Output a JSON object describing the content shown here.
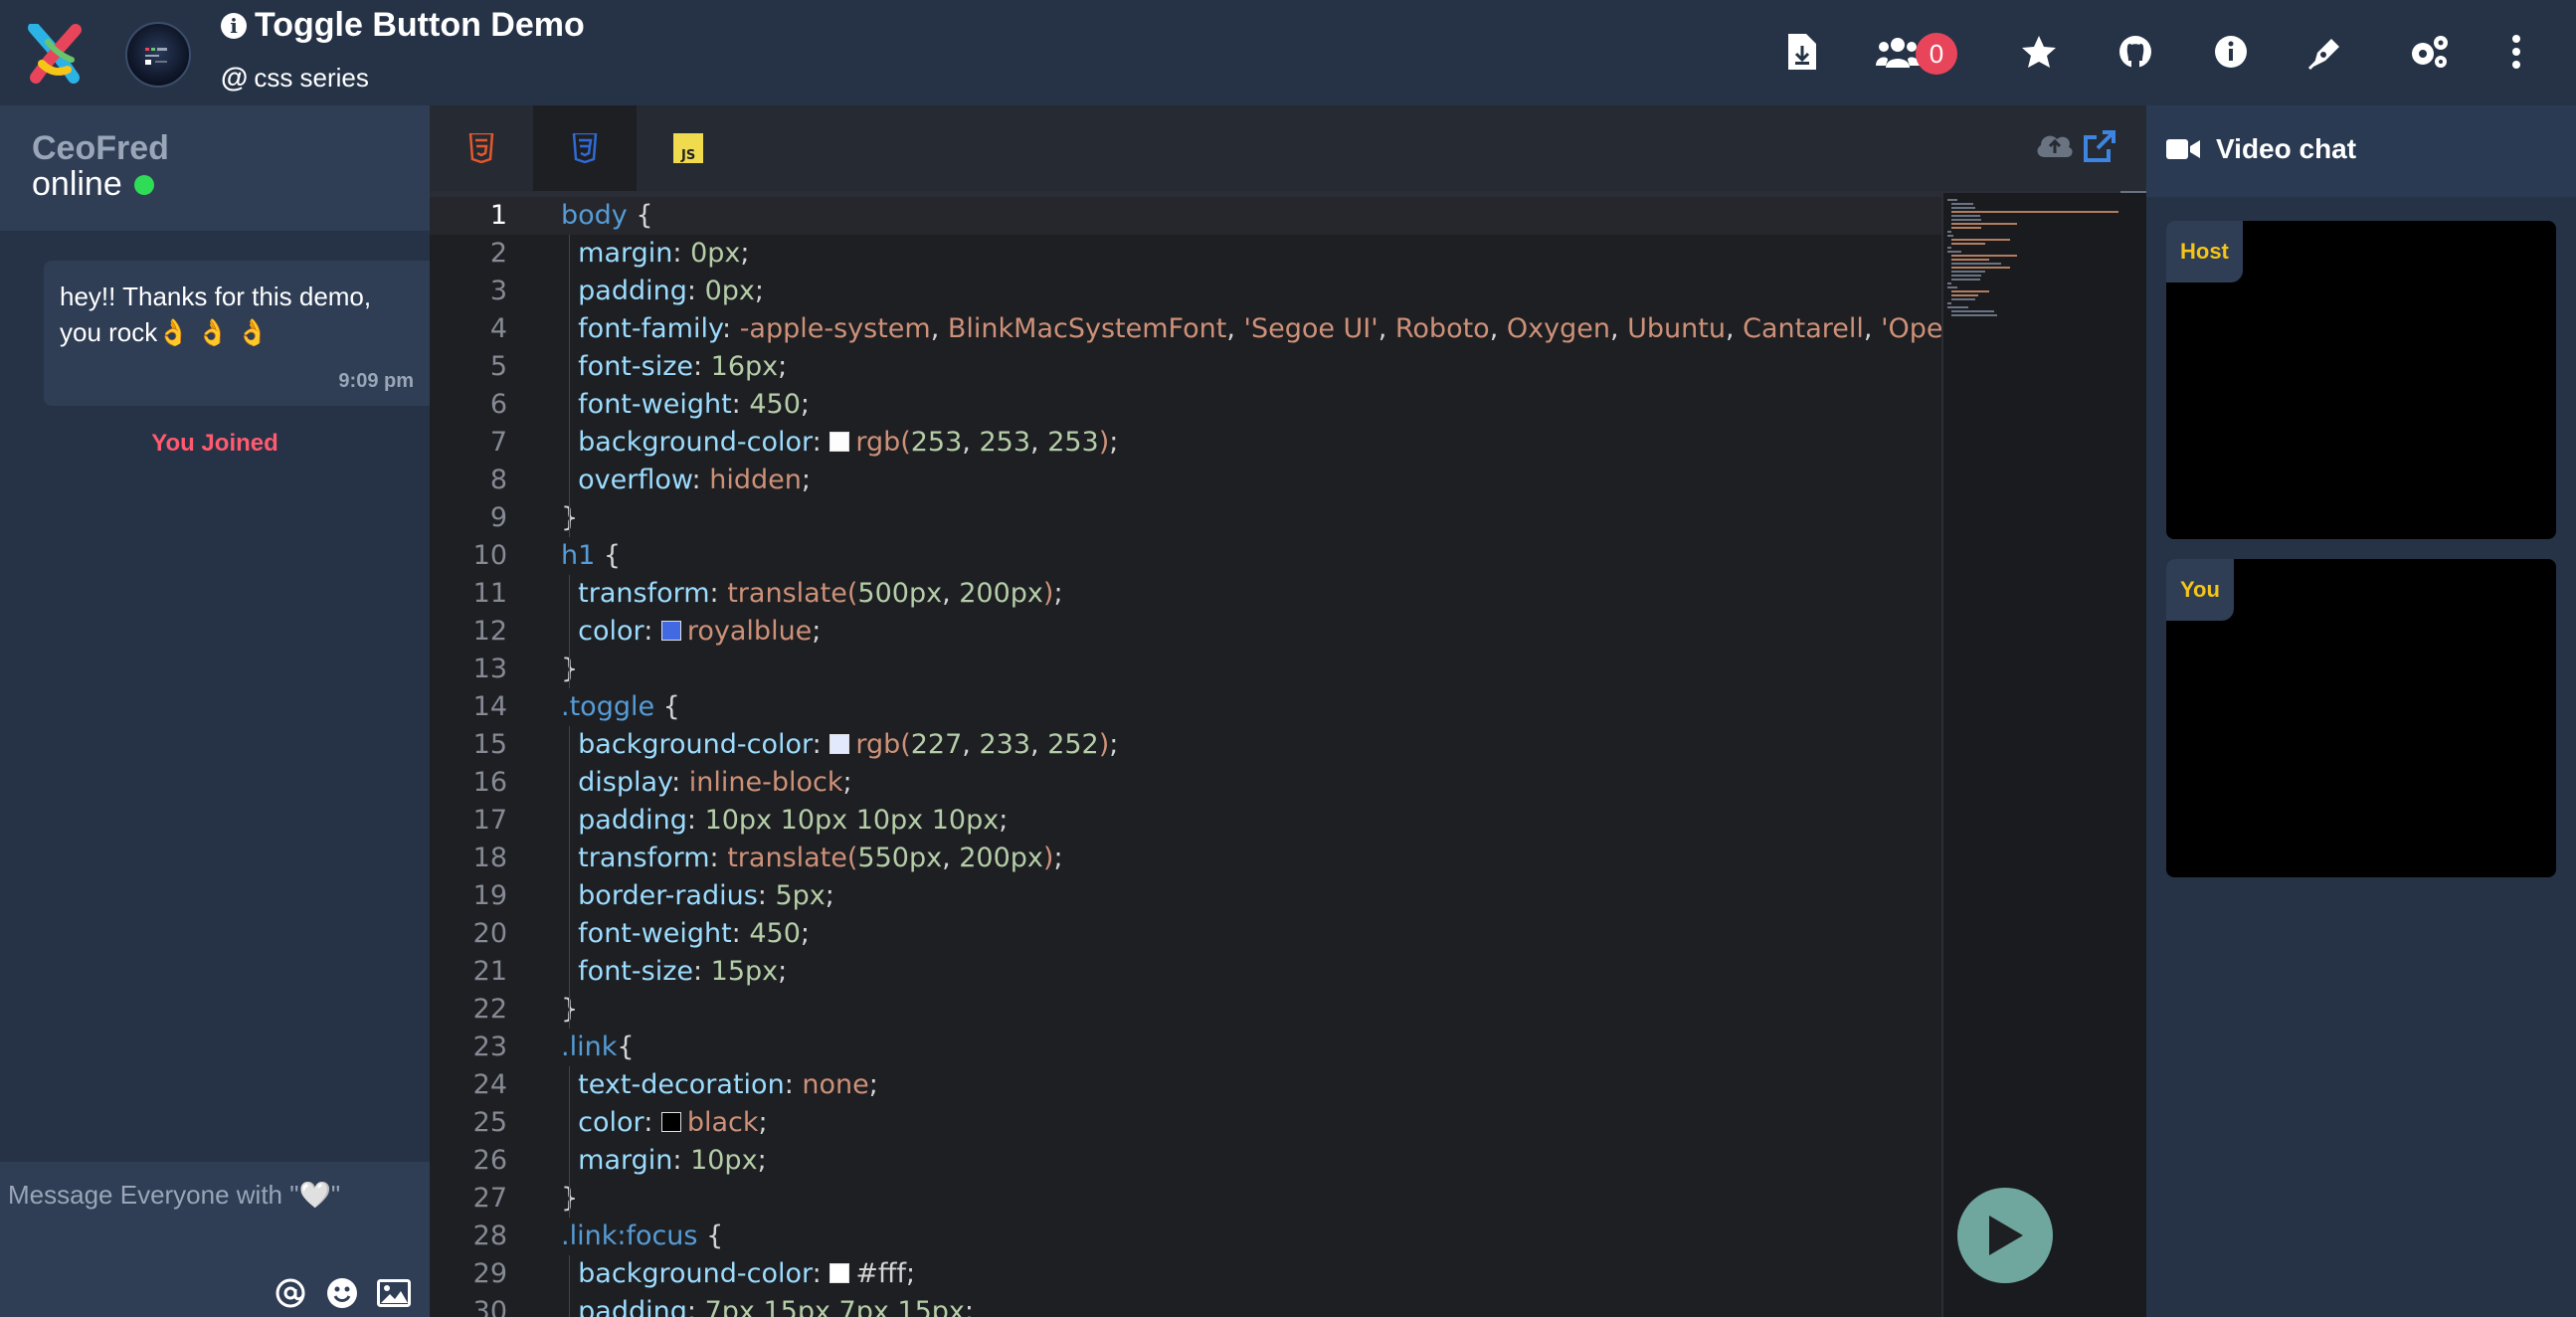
{
  "header": {
    "title": "Toggle Button Demo",
    "subtitle": "css series",
    "participant_count": "0",
    "icons": [
      "download-file-icon",
      "users-icon",
      "star-icon",
      "github-icon",
      "info-icon",
      "pen-icon",
      "settings-icon",
      "more-vertical-icon"
    ]
  },
  "chat": {
    "user_name": "CeoFred",
    "status": "online",
    "message_text": "hey!! Thanks for this demo, you rock👌 👌 👌",
    "message_time": "9:09 pm",
    "event_text": "You Joined",
    "composer_placeholder": "Message Everyone with \"🤍\""
  },
  "editor": {
    "tabs": [
      {
        "label": "HTML",
        "color": "#e4582c"
      },
      {
        "label": "CSS",
        "color": "#2f6ad6"
      },
      {
        "label": "JS",
        "color": "#f0db4f"
      }
    ],
    "active_tab": "CSS",
    "current_line": 1,
    "lines": [
      {
        "n": "1",
        "t": [
          [
            "sel",
            "body"
          ],
          [
            "p",
            " {"
          ]
        ]
      },
      {
        "n": "2",
        "t": [
          [
            "prop",
            "  margin"
          ],
          [
            "p",
            ": "
          ],
          [
            "num",
            "0px"
          ],
          [
            "p",
            ";"
          ]
        ]
      },
      {
        "n": "3",
        "t": [
          [
            "prop",
            "  padding"
          ],
          [
            "p",
            ": "
          ],
          [
            "num",
            "0px"
          ],
          [
            "p",
            ";"
          ]
        ]
      },
      {
        "n": "4",
        "t": [
          [
            "prop",
            "  font-family"
          ],
          [
            "p",
            ": "
          ],
          [
            "val",
            "-apple-system"
          ],
          [
            "p",
            ", "
          ],
          [
            "val",
            "BlinkMacSystemFont"
          ],
          [
            "p",
            ", "
          ],
          [
            "val",
            "'Segoe UI'"
          ],
          [
            "p",
            ", "
          ],
          [
            "val",
            "Roboto"
          ],
          [
            "p",
            ", "
          ],
          [
            "val",
            "Oxygen"
          ],
          [
            "p",
            ", "
          ],
          [
            "val",
            "Ubuntu"
          ],
          [
            "p",
            ", "
          ],
          [
            "val",
            "Cantarell"
          ],
          [
            "p",
            ", "
          ],
          [
            "val",
            "'Open Sa"
          ]
        ]
      },
      {
        "n": "5",
        "t": [
          [
            "prop",
            "  font-size"
          ],
          [
            "p",
            ": "
          ],
          [
            "num",
            "16px"
          ],
          [
            "p",
            ";"
          ]
        ]
      },
      {
        "n": "6",
        "t": [
          [
            "prop",
            "  font-weight"
          ],
          [
            "p",
            ": "
          ],
          [
            "num",
            "450"
          ],
          [
            "p",
            ";"
          ]
        ]
      },
      {
        "n": "7",
        "t": [
          [
            "prop",
            "  background-color"
          ],
          [
            "p",
            ": "
          ],
          [
            "sw",
            "#fdfdfd"
          ],
          [
            "val",
            "rgb("
          ],
          [
            "num",
            "253"
          ],
          [
            "p",
            ", "
          ],
          [
            "num",
            "253"
          ],
          [
            "p",
            ", "
          ],
          [
            "num",
            "253"
          ],
          [
            "val",
            ")"
          ],
          [
            "p",
            ";"
          ]
        ]
      },
      {
        "n": "8",
        "t": [
          [
            "prop",
            "  overflow"
          ],
          [
            "p",
            ": "
          ],
          [
            "val",
            "hidden"
          ],
          [
            "p",
            ";"
          ]
        ]
      },
      {
        "n": "9",
        "t": [
          [
            "p",
            "}"
          ]
        ]
      },
      {
        "n": "10",
        "t": [
          [
            "sel",
            "h1"
          ],
          [
            "p",
            " {"
          ]
        ]
      },
      {
        "n": "11",
        "t": [
          [
            "prop",
            "  transform"
          ],
          [
            "p",
            ": "
          ],
          [
            "val",
            "translate("
          ],
          [
            "num",
            "500px"
          ],
          [
            "p",
            ", "
          ],
          [
            "num",
            "200px"
          ],
          [
            "val",
            ")"
          ],
          [
            "p",
            ";"
          ]
        ]
      },
      {
        "n": "12",
        "t": [
          [
            "prop",
            "  color"
          ],
          [
            "p",
            ": "
          ],
          [
            "sw",
            "#4169e1"
          ],
          [
            "val",
            "royalblue"
          ],
          [
            "p",
            ";"
          ]
        ]
      },
      {
        "n": "13",
        "t": [
          [
            "p",
            "}"
          ]
        ]
      },
      {
        "n": "14",
        "t": [
          [
            "sel",
            ".toggle"
          ],
          [
            "p",
            " {"
          ]
        ]
      },
      {
        "n": "15",
        "t": [
          [
            "prop",
            "  background-color"
          ],
          [
            "p",
            ": "
          ],
          [
            "sw",
            "#e3e9fc"
          ],
          [
            "val",
            "rgb("
          ],
          [
            "num",
            "227"
          ],
          [
            "p",
            ", "
          ],
          [
            "num",
            "233"
          ],
          [
            "p",
            ", "
          ],
          [
            "num",
            "252"
          ],
          [
            "val",
            ")"
          ],
          [
            "p",
            ";"
          ]
        ]
      },
      {
        "n": "16",
        "t": [
          [
            "prop",
            "  display"
          ],
          [
            "p",
            ": "
          ],
          [
            "val",
            "inline-block"
          ],
          [
            "p",
            ";"
          ]
        ]
      },
      {
        "n": "17",
        "t": [
          [
            "prop",
            "  padding"
          ],
          [
            "p",
            ": "
          ],
          [
            "num",
            "10px 10px 10px 10px"
          ],
          [
            "p",
            ";"
          ]
        ]
      },
      {
        "n": "18",
        "t": [
          [
            "prop",
            "  transform"
          ],
          [
            "p",
            ": "
          ],
          [
            "val",
            "translate("
          ],
          [
            "num",
            "550px"
          ],
          [
            "p",
            ", "
          ],
          [
            "num",
            "200px"
          ],
          [
            "val",
            ")"
          ],
          [
            "p",
            ";"
          ]
        ]
      },
      {
        "n": "19",
        "t": [
          [
            "prop",
            "  border-radius"
          ],
          [
            "p",
            ": "
          ],
          [
            "num",
            "5px"
          ],
          [
            "p",
            ";"
          ]
        ]
      },
      {
        "n": "20",
        "t": [
          [
            "prop",
            "  font-weight"
          ],
          [
            "p",
            ": "
          ],
          [
            "num",
            "450"
          ],
          [
            "p",
            ";"
          ]
        ]
      },
      {
        "n": "21",
        "t": [
          [
            "prop",
            "  font-size"
          ],
          [
            "p",
            ": "
          ],
          [
            "num",
            "15px"
          ],
          [
            "p",
            ";"
          ]
        ]
      },
      {
        "n": "22",
        "t": [
          [
            "p",
            "}"
          ]
        ]
      },
      {
        "n": "23",
        "t": [
          [
            "sel",
            ".link"
          ],
          [
            "p",
            "{"
          ]
        ]
      },
      {
        "n": "24",
        "t": [
          [
            "prop",
            "  text-decoration"
          ],
          [
            "p",
            ": "
          ],
          [
            "val",
            "none"
          ],
          [
            "p",
            ";"
          ]
        ]
      },
      {
        "n": "25",
        "t": [
          [
            "prop",
            "  color"
          ],
          [
            "p",
            ": "
          ],
          [
            "sw",
            "#000000"
          ],
          [
            "val",
            "black"
          ],
          [
            "p",
            ";"
          ]
        ]
      },
      {
        "n": "26",
        "t": [
          [
            "prop",
            "  margin"
          ],
          [
            "p",
            ": "
          ],
          [
            "num",
            "10px"
          ],
          [
            "p",
            ";"
          ]
        ]
      },
      {
        "n": "27",
        "t": [
          [
            "p",
            "}"
          ]
        ]
      },
      {
        "n": "28",
        "t": [
          [
            "sel",
            ".link"
          ],
          [
            "sel",
            ":focus"
          ],
          [
            "p",
            " {"
          ]
        ]
      },
      {
        "n": "29",
        "t": [
          [
            "prop",
            "  background-color"
          ],
          [
            "p",
            ": "
          ],
          [
            "sw",
            "#ffffff"
          ],
          [
            "p",
            "#fff;"
          ]
        ]
      },
      {
        "n": "30",
        "t": [
          [
            "prop",
            "  padding"
          ],
          [
            "p",
            ": "
          ],
          [
            "num",
            "7px 15px 7px 15px"
          ],
          [
            "p",
            ";"
          ]
        ]
      }
    ]
  },
  "video": {
    "title": "Video chat",
    "host_label": "Host",
    "you_label": "You"
  }
}
